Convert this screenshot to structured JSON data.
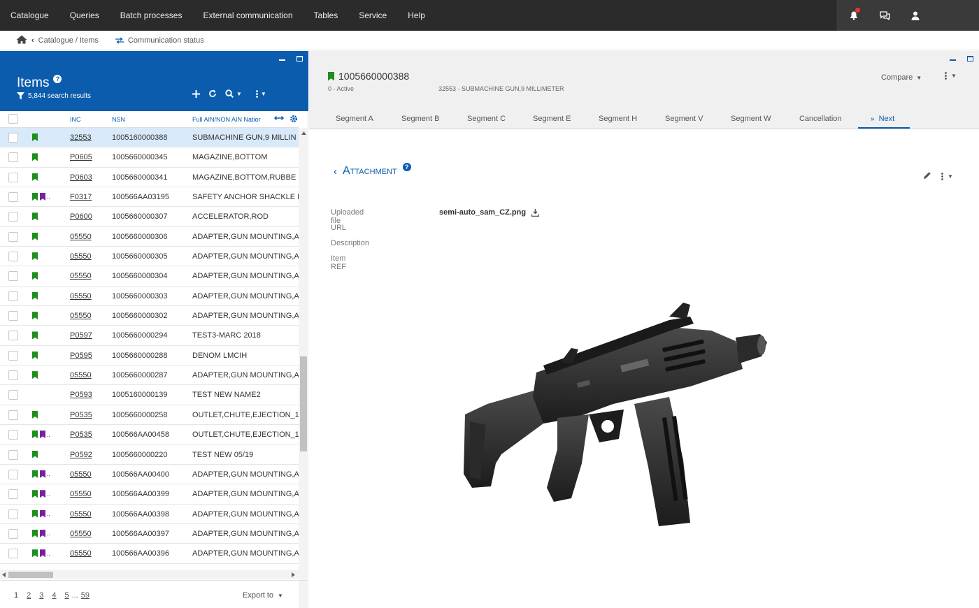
{
  "topnav": {
    "menu": [
      "Catalogue",
      "Queries",
      "Batch processes",
      "External communication",
      "Tables",
      "Service",
      "Help"
    ],
    "icons": [
      "notification-bell-icon",
      "chat-icon",
      "user-icon"
    ]
  },
  "breadcrumb": {
    "path": "Catalogue / Items",
    "communication": "Communication status"
  },
  "items_panel": {
    "title": "Items",
    "results": "5,844 search results",
    "columns": {
      "inc": "INC",
      "nsn": "NSN",
      "name": "Full AIN/NON AIN Natior"
    },
    "rows": [
      {
        "inc": "32553",
        "nsn": "1005160000388",
        "name": "SUBMACHINE GUN,9 MILLIN",
        "flags": "green",
        "selected": true
      },
      {
        "inc": "P0605",
        "nsn": "1005660000345",
        "name": "MAGAZINE,BOTTOM",
        "flags": "green"
      },
      {
        "inc": "P0603",
        "nsn": "1005660000341",
        "name": "MAGAZINE,BOTTOM,RUBBE",
        "flags": "green"
      },
      {
        "inc": "F0317",
        "nsn": "100566AA03195",
        "name": "SAFETY ANCHOR SHACKLE B",
        "flags": "green-purple"
      },
      {
        "inc": "P0600",
        "nsn": "1005660000307",
        "name": "ACCELERATOR,ROD",
        "flags": "green"
      },
      {
        "inc": "05550",
        "nsn": "1005660000306",
        "name": "ADAPTER,GUN MOUNTING,A",
        "flags": "green"
      },
      {
        "inc": "05550",
        "nsn": "1005660000305",
        "name": "ADAPTER,GUN MOUNTING,A",
        "flags": "green"
      },
      {
        "inc": "05550",
        "nsn": "1005660000304",
        "name": "ADAPTER,GUN MOUNTING,A",
        "flags": "green"
      },
      {
        "inc": "05550",
        "nsn": "1005660000303",
        "name": "ADAPTER,GUN MOUNTING,A",
        "flags": "green"
      },
      {
        "inc": "05550",
        "nsn": "1005660000302",
        "name": "ADAPTER,GUN MOUNTING,A",
        "flags": "green"
      },
      {
        "inc": "P0597",
        "nsn": "1005660000294",
        "name": "TEST3-MARC 2018",
        "flags": "green"
      },
      {
        "inc": "P0595",
        "nsn": "1005660000288",
        "name": "DENOM LMCIH",
        "flags": "green"
      },
      {
        "inc": "05550",
        "nsn": "1005660000287",
        "name": "ADAPTER,GUN MOUNTING,A",
        "flags": "green"
      },
      {
        "inc": "P0593",
        "nsn": "1005160000139",
        "name": "TEST NEW NAME2",
        "flags": "none"
      },
      {
        "inc": "P0535",
        "nsn": "1005660000258",
        "name": "OUTLET,CHUTE,EJECTION_1",
        "flags": "green"
      },
      {
        "inc": "P0535",
        "nsn": "100566AA00458",
        "name": "OUTLET,CHUTE,EJECTION_1",
        "flags": "green-purple"
      },
      {
        "inc": "P0592",
        "nsn": "1005660000220",
        "name": "TEST NEW 05/19",
        "flags": "green"
      },
      {
        "inc": "05550",
        "nsn": "100566AA00400",
        "name": "ADAPTER,GUN MOUNTING,A",
        "flags": "green-purple"
      },
      {
        "inc": "05550",
        "nsn": "100566AA00399",
        "name": "ADAPTER,GUN MOUNTING,A",
        "flags": "green-purple"
      },
      {
        "inc": "05550",
        "nsn": "100566AA00398",
        "name": "ADAPTER,GUN MOUNTING,A",
        "flags": "green-purple"
      },
      {
        "inc": "05550",
        "nsn": "100566AA00397",
        "name": "ADAPTER,GUN MOUNTING,A",
        "flags": "green-purple"
      },
      {
        "inc": "05550",
        "nsn": "100566AA00396",
        "name": "ADAPTER,GUN MOUNTING,A",
        "flags": "green-purple"
      }
    ],
    "pager": {
      "pages": [
        "1",
        "2",
        "3",
        "4",
        "5",
        "...",
        "59"
      ],
      "current": "1",
      "export_label": "Export to"
    }
  },
  "record": {
    "nsn": "1005660000388",
    "status": "0 - Active",
    "description": "32553 - SUBMACHINE GUN,9 MILLIMETER",
    "compare_label": "Compare",
    "tabs": [
      "Segment A",
      "Segment B",
      "Segment C",
      "Segment E",
      "Segment H",
      "Segment V",
      "Segment W",
      "Cancellation"
    ],
    "next_tab": "Next",
    "next_prefix": "»"
  },
  "attachment": {
    "title": "Attachment",
    "fields": [
      {
        "label": "Uploaded file",
        "value": "semi-auto_sam_CZ.png"
      },
      {
        "label": "URL",
        "value": ""
      },
      {
        "label": "Description",
        "value": ""
      },
      {
        "label": "Item REF",
        "value": ""
      }
    ],
    "image_icon": "submachine-gun-image"
  },
  "colors": {
    "topbar": "#2b2b2b",
    "accent": "#0b5cad",
    "flag_green": "#1e8e1e",
    "flag_purple": "#7b1fa2",
    "selected_row": "#d8e9fa"
  }
}
